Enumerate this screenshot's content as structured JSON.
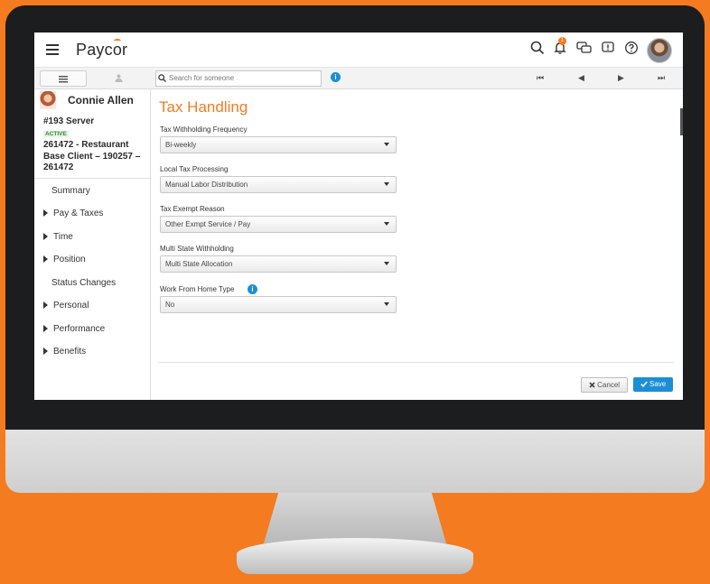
{
  "app": {
    "logo_text": "Paycor",
    "logo_o": "o"
  },
  "topbar": {
    "notification_count": "1",
    "icons": [
      "search-icon",
      "bell-icon",
      "chat-icon",
      "feedback-icon",
      "help-icon",
      "avatar"
    ]
  },
  "subbar": {
    "search_placeholder": "Search for someone",
    "nav": [
      "⏮",
      "◀",
      "▶",
      "⏭"
    ]
  },
  "employee": {
    "name": "Connie Allen",
    "role": "#193 Server",
    "status": "ACTIVE",
    "client": "261472 - Restaurant Base Client – 190257 – 261472"
  },
  "sidebar": {
    "items": [
      {
        "label": "Summary",
        "expandable": false
      },
      {
        "label": "Pay & Taxes",
        "expandable": true
      },
      {
        "label": "Time",
        "expandable": true
      },
      {
        "label": "Position",
        "expandable": true
      },
      {
        "label": "Status Changes",
        "expandable": false
      },
      {
        "label": "Personal",
        "expandable": true
      },
      {
        "label": "Performance",
        "expandable": true
      },
      {
        "label": "Benefits",
        "expandable": true
      }
    ]
  },
  "form": {
    "title": "Tax Handling",
    "fields": [
      {
        "label": "Tax Withholding Frequency",
        "value": "Bi-weekly"
      },
      {
        "label": "Local Tax Processing",
        "value": "Manual Labor Distribution"
      },
      {
        "label": "Tax Exempt Reason",
        "value": "Other Exmpt Service / Pay"
      },
      {
        "label": "Multi State Withholding",
        "value": "Multi State Allocation"
      },
      {
        "label": "Work From Home Type",
        "value": "No"
      }
    ],
    "cancel_label": "Cancel",
    "save_label": "Save"
  },
  "colors": {
    "accent": "#f47b20",
    "primary": "#1a8fd6",
    "status": "#2e8b2e"
  }
}
